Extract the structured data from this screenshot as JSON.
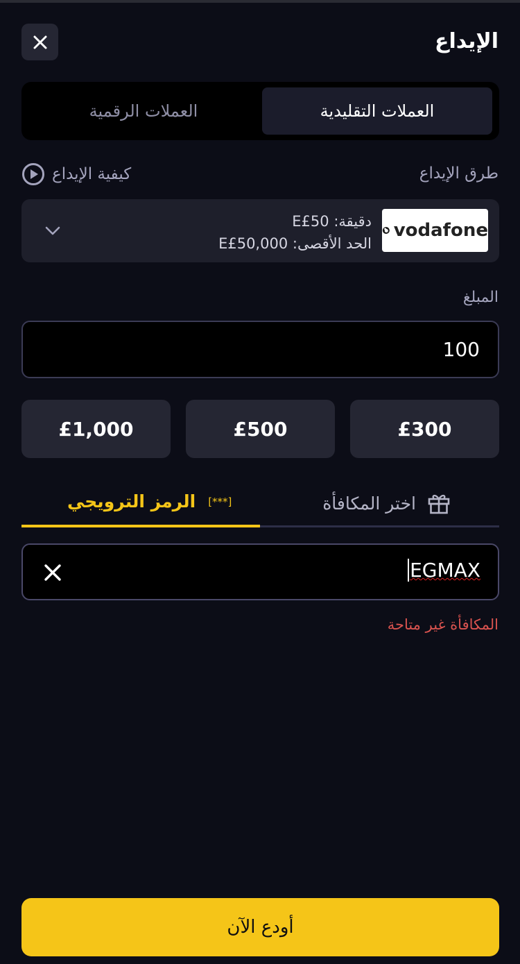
{
  "header": {
    "title": "الإيداع",
    "close_icon": "close-icon"
  },
  "currency_tabs": {
    "fiat": "العملات التقليدية",
    "crypto": "العملات الرقمية",
    "active": "fiat"
  },
  "methods": {
    "label": "طرق الإيداع",
    "how_to": "كيفية الإيداع",
    "selected": {
      "logo_text": "vodafone",
      "min_line": "دقيقة: E£50",
      "max_line": "الحد الأقصى: E£50,000"
    }
  },
  "amount": {
    "label": "المبلغ",
    "value": "100",
    "presets": [
      "£300",
      "£500",
      "£1,000"
    ]
  },
  "bonus_tabs": {
    "choose_bonus": "اختر المكافأة",
    "promo_code": "الرمز الترويجي",
    "promo_badge": "[***]",
    "active": "promo_code"
  },
  "promo": {
    "value": "EGMAX",
    "error": "المكافأة غير متاحة"
  },
  "footer": {
    "deposit_button": "أودع الآن"
  },
  "colors": {
    "accent": "#f5c518",
    "background": "#0c0d17",
    "error": "#d9534f"
  }
}
